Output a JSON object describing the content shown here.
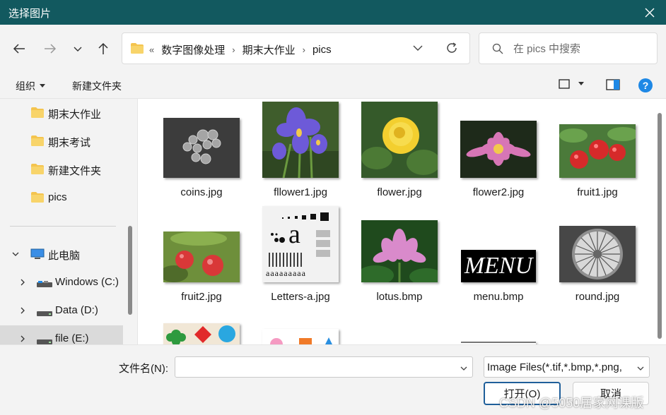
{
  "window": {
    "title": "选择图片"
  },
  "nav": {
    "crumbs_prefix": "«",
    "crumbs": [
      "数字图像处理",
      "期末大作业",
      "pics"
    ],
    "search_placeholder": "在 pics 中搜索"
  },
  "toolbar": {
    "organize_label": "组织",
    "new_folder_label": "新建文件夹"
  },
  "sidebar": {
    "items": [
      {
        "label": "期末大作业",
        "type": "folder"
      },
      {
        "label": "期末考试",
        "type": "folder"
      },
      {
        "label": "新建文件夹",
        "type": "folder"
      },
      {
        "label": "pics",
        "type": "folder"
      },
      {
        "label": "此电脑",
        "type": "computer"
      },
      {
        "label": "Windows (C:)",
        "type": "drive"
      },
      {
        "label": "Data (D:)",
        "type": "drive"
      },
      {
        "label": "file (E:)",
        "type": "drive",
        "selected": true
      }
    ]
  },
  "files": [
    {
      "name": "coins.jpg"
    },
    {
      "name": "fllower1.jpg"
    },
    {
      "name": "flower.jpg"
    },
    {
      "name": "flower2.jpg"
    },
    {
      "name": "fruit1.jpg"
    },
    {
      "name": "fruit2.jpg"
    },
    {
      "name": "Letters-a.jpg"
    },
    {
      "name": "lotus.bmp"
    },
    {
      "name": "menu.bmp"
    },
    {
      "name": "round.jpg"
    }
  ],
  "thumb_text": {
    "menu": "MENU",
    "letters": "a",
    "letters_row": "a a a a a a a a a"
  },
  "bottom": {
    "filename_label": "文件名(N):",
    "filename_value": "",
    "filetype": "Image Files(*.tif,*.bmp,*.png,",
    "open_label": "打开(O)",
    "cancel_label": "取消"
  },
  "watermark": "CSDN @5050居家网课版",
  "colors": {
    "titlebar": "#12595f",
    "accent": "#1f5f9a",
    "folder": "#f4c44e",
    "help": "#1e88e5"
  }
}
